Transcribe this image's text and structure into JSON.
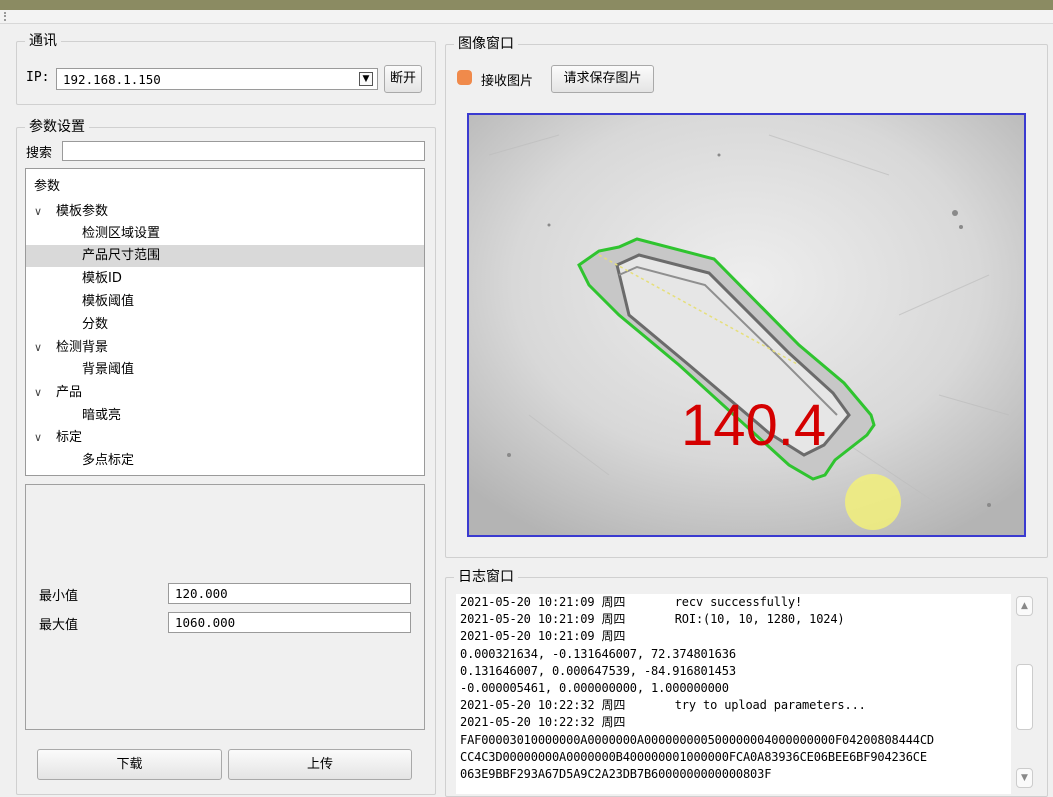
{
  "comm": {
    "title": "通讯",
    "ip_label": "IP:",
    "ip_value": "192.168.1.150",
    "disconnect_label": "断开"
  },
  "params": {
    "title": "参数设置",
    "search_label": "搜索",
    "search_value": "",
    "tree_header": "参数",
    "tree": [
      {
        "label": "模板参数",
        "level": 0,
        "expanded": true
      },
      {
        "label": "检测区域设置",
        "level": 1
      },
      {
        "label": "产品尺寸范围",
        "level": 1,
        "selected": true
      },
      {
        "label": "模板ID",
        "level": 1
      },
      {
        "label": "模板阈值",
        "level": 1
      },
      {
        "label": "分数",
        "level": 1
      },
      {
        "label": "检测背景",
        "level": 0,
        "expanded": true
      },
      {
        "label": "背景阈值",
        "level": 1
      },
      {
        "label": "产品",
        "level": 0,
        "expanded": true
      },
      {
        "label": "暗或亮",
        "level": 1
      },
      {
        "label": "标定",
        "level": 0,
        "expanded": true
      },
      {
        "label": "多点标定",
        "level": 1
      }
    ],
    "min_label": "最小值",
    "min_value": "120.000",
    "max_label": "最大值",
    "max_value": "1060.000",
    "download_label": "下载",
    "upload_label": "上传"
  },
  "image_window": {
    "title": "图像窗口",
    "recv_label": "接收图片",
    "save_request_label": "请求保存图片",
    "measurement": "140.4",
    "indicator_color": "#f08a4b",
    "overlay_color": "#d40000",
    "contour_color": "#2fc42f"
  },
  "log_window": {
    "title": "日志窗口",
    "lines": [
      "2021-05-20 10:21:09 周四       recv successfully!",
      "2021-05-20 10:21:09 周四       ROI:(10, 10, 1280, 1024)",
      "2021-05-20 10:21:09 周四",
      "0.000321634, -0.131646007, 72.374801636",
      "0.131646007, 0.000647539, -84.916801453",
      "-0.000005461, 0.000000000, 1.000000000",
      "2021-05-20 10:22:32 周四       try to upload parameters...",
      "2021-05-20 10:22:32 周四",
      "FAF00003010000000A0000000A000000000500000004000000000F04200808444CD",
      "CC4C3D00000000A0000000B400000001000000FCA0A83936CE06BEE6BF904236CE",
      "063E9BBF293A67D5A9C2A23DB7B6000000000000803F"
    ]
  }
}
